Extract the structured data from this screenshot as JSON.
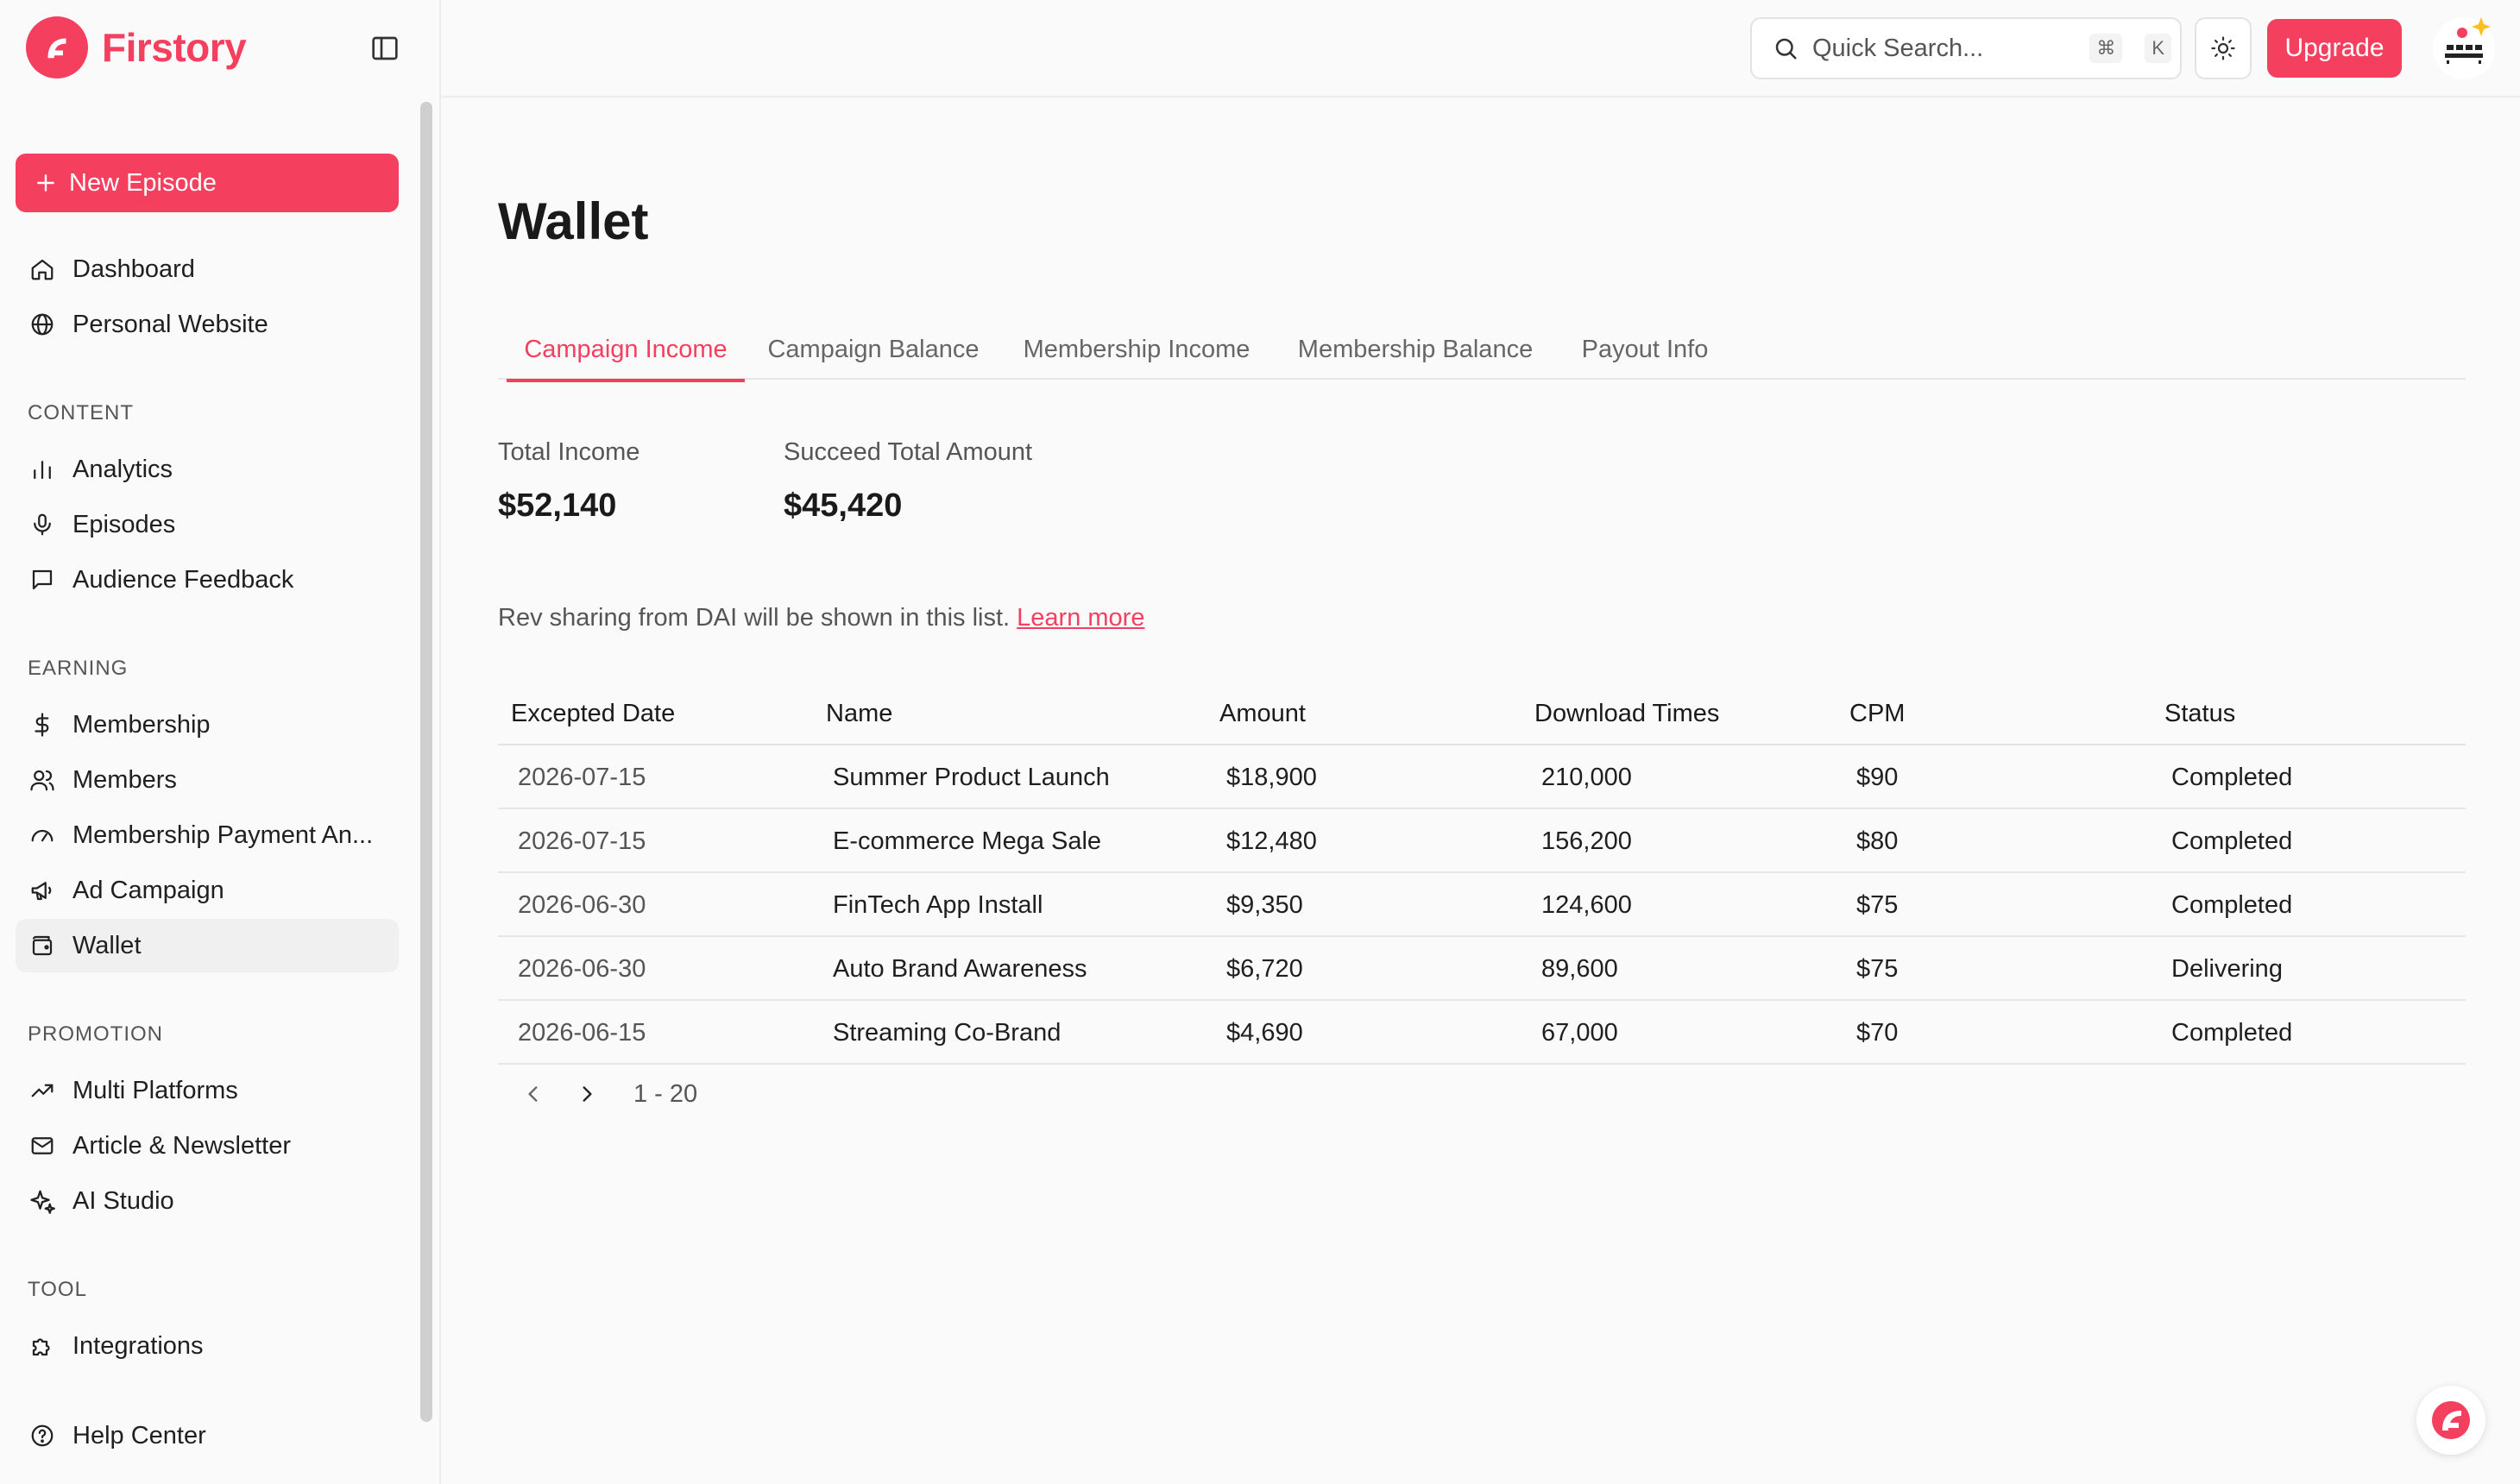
{
  "app": {
    "name": "Firstory",
    "brand_color": "#f43f5e"
  },
  "sidebar": {
    "new_episode_label": "New Episode",
    "top_items": [
      {
        "label": "Dashboard",
        "icon": "home-icon"
      },
      {
        "label": "Personal Website",
        "icon": "globe-icon"
      }
    ],
    "sections": [
      {
        "label": "CONTENT",
        "items": [
          {
            "label": "Analytics",
            "icon": "bar-chart-icon"
          },
          {
            "label": "Episodes",
            "icon": "microphone-icon"
          },
          {
            "label": "Audience Feedback",
            "icon": "message-square-icon"
          }
        ]
      },
      {
        "label": "EARNING",
        "items": [
          {
            "label": "Membership",
            "icon": "dollar-icon"
          },
          {
            "label": "Members",
            "icon": "users-icon"
          },
          {
            "label": "Membership Payment An...",
            "icon": "gauge-icon"
          },
          {
            "label": "Ad Campaign",
            "icon": "megaphone-icon"
          },
          {
            "label": "Wallet",
            "icon": "wallet-icon",
            "active": true
          }
        ]
      },
      {
        "label": "PROMOTION",
        "items": [
          {
            "label": "Multi Platforms",
            "icon": "trending-up-icon"
          },
          {
            "label": "Article & Newsletter",
            "icon": "mail-icon"
          },
          {
            "label": "AI Studio",
            "icon": "sparkles-icon"
          }
        ]
      },
      {
        "label": "TOOL",
        "items": [
          {
            "label": "Integrations",
            "icon": "puzzle-icon"
          }
        ]
      }
    ],
    "help_label": "Help Center"
  },
  "topbar": {
    "search_placeholder": "Quick Search...",
    "shortcut_cmd": "⌘",
    "shortcut_key": "K",
    "upgrade_label": "Upgrade"
  },
  "main": {
    "title": "Wallet",
    "tabs": [
      {
        "label": "Campaign Income",
        "active": true
      },
      {
        "label": "Campaign Balance"
      },
      {
        "label": "Membership Income"
      },
      {
        "label": "Membership Balance"
      },
      {
        "label": "Payout Info"
      }
    ],
    "stats": [
      {
        "label": "Total Income",
        "value": "$52,140"
      },
      {
        "label": "Succeed Total Amount",
        "value": "$45,420"
      }
    ],
    "note_text": "Rev sharing from DAI will be shown in this list.",
    "note_link": "Learn more",
    "table": {
      "columns": [
        "Excepted Date",
        "Name",
        "Amount",
        "Download Times",
        "CPM",
        "Status"
      ],
      "rows": [
        [
          "2026-07-15",
          "Summer Product Launch",
          "$18,900",
          "210,000",
          "$90",
          "Completed"
        ],
        [
          "2026-07-15",
          "E-commerce Mega Sale",
          "$12,480",
          "156,200",
          "$80",
          "Completed"
        ],
        [
          "2026-06-30",
          "FinTech App Install",
          "$9,350",
          "124,600",
          "$75",
          "Completed"
        ],
        [
          "2026-06-30",
          "Auto Brand Awareness",
          "$6,720",
          "89,600",
          "$75",
          "Delivering"
        ],
        [
          "2026-06-15",
          "Streaming Co-Brand",
          "$4,690",
          "67,000",
          "$70",
          "Completed"
        ]
      ]
    },
    "pagination": "1 - 20"
  }
}
